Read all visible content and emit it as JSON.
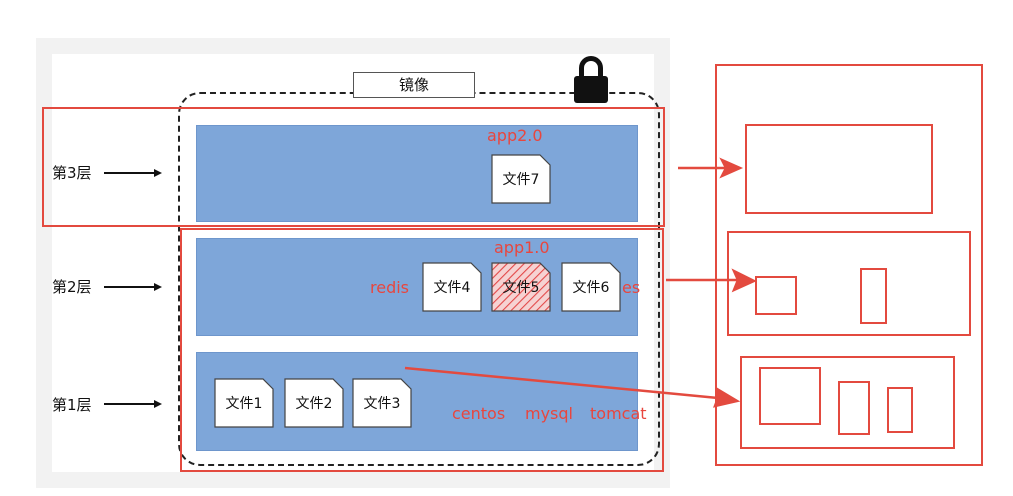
{
  "image_label": "镜像",
  "layer_labels": [
    "第3层",
    "第2层",
    "第1层"
  ],
  "files": {
    "f1": "文件1",
    "f2": "文件2",
    "f3": "文件3",
    "f4": "文件4",
    "f5": "文件5",
    "f6": "文件6",
    "f7": "文件7"
  },
  "annotations": {
    "app2": "app2.0",
    "app1": "app1.0",
    "redis": "redis",
    "es": "es",
    "centos": "centos",
    "mysql": "mysql",
    "tomcat": "tomcat"
  },
  "colors": {
    "layer_fill": "#7ea6d9",
    "annotation_red": "#e34a3f"
  },
  "icons": [
    "lock-icon",
    "arrow-right-icon"
  ]
}
